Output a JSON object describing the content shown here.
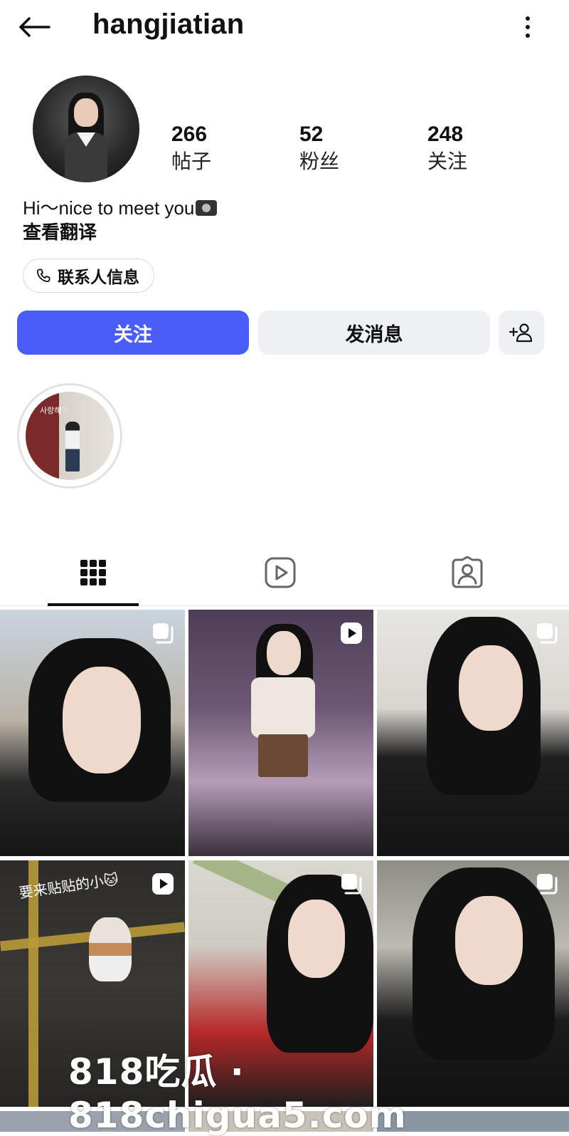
{
  "header": {
    "username": "hangjiatian"
  },
  "stats": [
    {
      "value": "266",
      "label": "帖子"
    },
    {
      "value": "52",
      "label": "粉丝"
    },
    {
      "value": "248",
      "label": "关注"
    }
  ],
  "bio": {
    "text": "Hi～nice to meet you",
    "translate": "查看翻译"
  },
  "contact": {
    "label": "联系人信息"
  },
  "actions": {
    "follow": "关注",
    "message": "发消息"
  },
  "highlight": {
    "caption": "사랑해♡"
  },
  "grid": {
    "posts": [
      {
        "type": "carousel"
      },
      {
        "type": "reel"
      },
      {
        "type": "carousel"
      },
      {
        "type": "reel",
        "caption": "要来贴贴的小🐱"
      },
      {
        "type": "carousel"
      },
      {
        "type": "carousel"
      }
    ]
  },
  "watermark": {
    "text": "818吃瓜 · 818chigua5.com"
  },
  "colors": {
    "follow_button": "#4a5df9",
    "secondary_button": "#eff0f3",
    "text": "#111111"
  }
}
